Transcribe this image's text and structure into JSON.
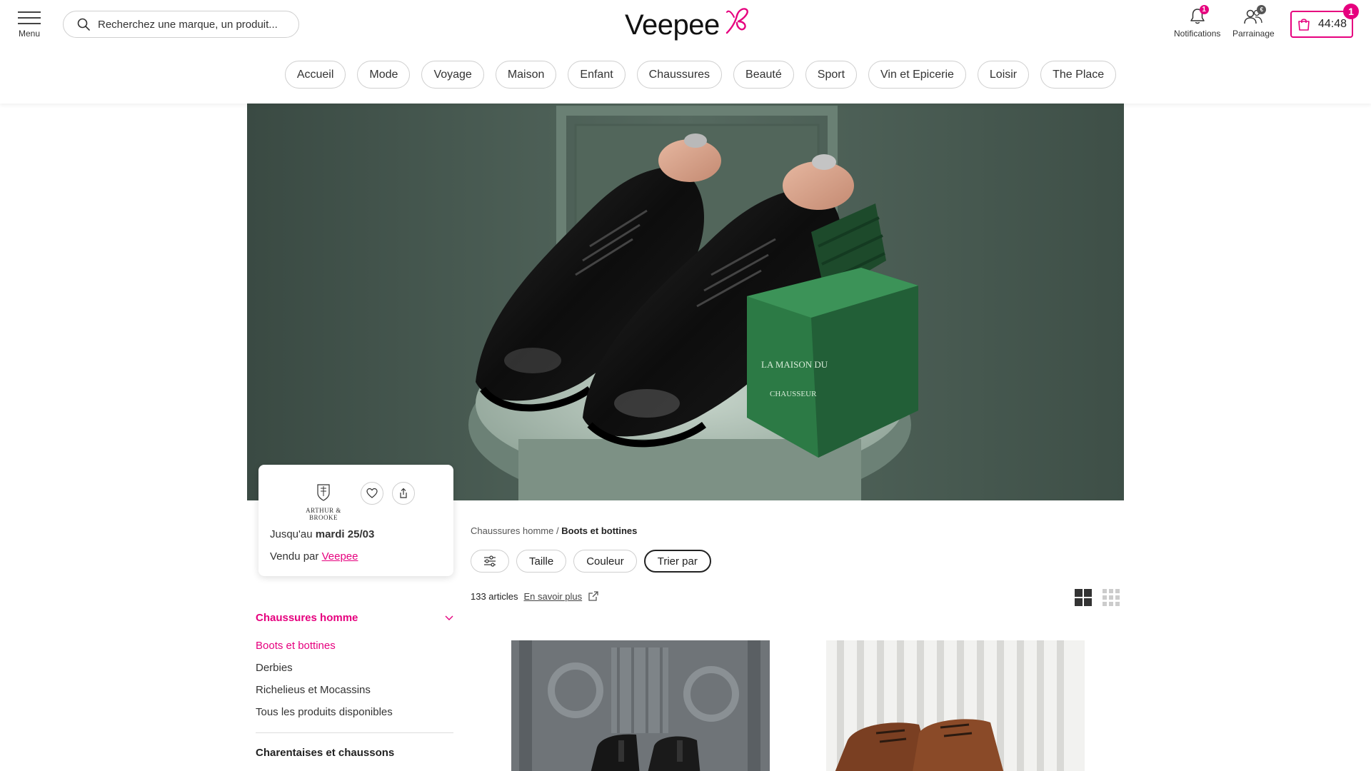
{
  "header": {
    "menu_label": "Menu",
    "search_placeholder": "Recherchez une marque, un produit...",
    "logo_text": "Veepee",
    "notifications": {
      "label": "Notifications",
      "badge": "1"
    },
    "referral": {
      "label": "Parrainage",
      "badge": "€"
    },
    "cart": {
      "timer": "44:48",
      "badge": "1"
    }
  },
  "nav": [
    "Accueil",
    "Mode",
    "Voyage",
    "Maison",
    "Enfant",
    "Chaussures",
    "Beauté",
    "Sport",
    "Vin et Epicerie",
    "Loisir",
    "The Place"
  ],
  "hero": {
    "box_text_top": "LA MAISON DU",
    "box_text_bottom": "CHAUSSEUR"
  },
  "brand_card": {
    "brand_name": "ARTHUR & BROOKE",
    "until_prefix": "Jusqu'au",
    "until_date": "mardi 25/03",
    "sold_prefix": "Vendu par",
    "sold_by": "Veepee"
  },
  "sidebar": {
    "category": "Chaussures homme",
    "items": [
      "Boots et bottines",
      "Derbies",
      "Richelieus et Mocassins",
      "Tous les produits disponibles"
    ],
    "next_category": "Charentaises et chaussons"
  },
  "breadcrumb": {
    "parent": "Chaussures homme",
    "separator": "/",
    "current": "Boots et bottines"
  },
  "filters": {
    "size": "Taille",
    "color": "Couleur",
    "sort": "Trier par"
  },
  "results": {
    "count": "133 articles",
    "learn_more": "En savoir plus"
  },
  "colors": {
    "accent": "#e6007e"
  }
}
